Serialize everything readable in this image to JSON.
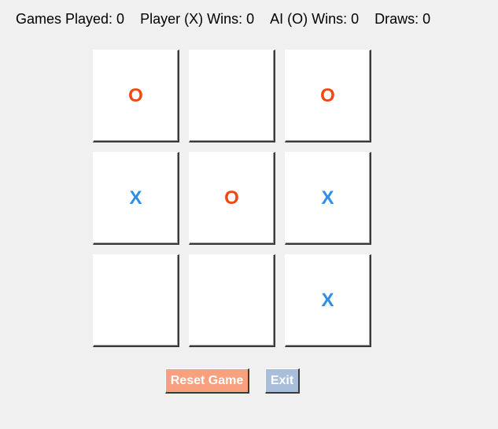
{
  "stats": {
    "games_played": "Games Played: 0",
    "player_wins": "Player (X) Wins: 0",
    "ai_wins": "AI (O) Wins: 0",
    "draws": "Draws: 0"
  },
  "board": {
    "cells": [
      "O",
      "",
      "O",
      "X",
      "O",
      "X",
      "",
      "",
      "X"
    ]
  },
  "buttons": {
    "reset_label": "Reset Game",
    "exit_label": "Exit"
  },
  "colors": {
    "x_mark": "#2e8ee8",
    "o_mark": "#f5460f",
    "reset_button": "#f9a07e",
    "exit_button": "#a8bedb",
    "background": "#f0f0f0"
  }
}
